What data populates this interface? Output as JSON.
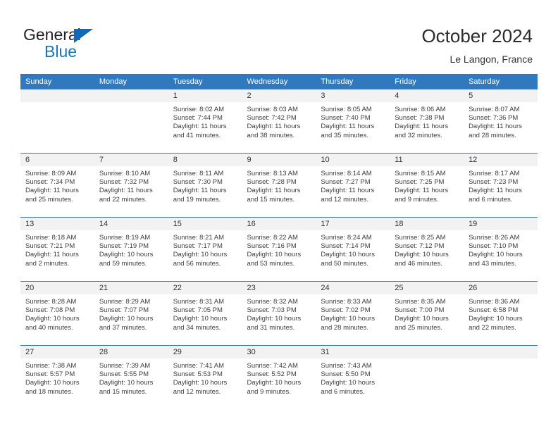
{
  "brand": {
    "name_part1": "General",
    "name_part2": "Blue",
    "logo_icon": "triangle-logo-icon",
    "accent_color": "#1b75bb"
  },
  "header": {
    "title": "October 2024",
    "subtitle": "Le Langon, France"
  },
  "colors": {
    "header_blue": "#3179be",
    "daynum_gray": "#f2f2f2",
    "text": "#3d3d3d"
  },
  "calendar": {
    "weekday_headers": [
      "Sunday",
      "Monday",
      "Tuesday",
      "Wednesday",
      "Thursday",
      "Friday",
      "Saturday"
    ],
    "labels": {
      "sunrise": "Sunrise:",
      "sunset": "Sunset:",
      "daylight": "Daylight:"
    },
    "weeks": [
      [
        {
          "day": "",
          "sunrise": "",
          "sunset": "",
          "daylight_line1": "",
          "daylight_line2": ""
        },
        {
          "day": "",
          "sunrise": "",
          "sunset": "",
          "daylight_line1": "",
          "daylight_line2": ""
        },
        {
          "day": "1",
          "sunrise": "Sunrise: 8:02 AM",
          "sunset": "Sunset: 7:44 PM",
          "daylight_line1": "Daylight: 11 hours",
          "daylight_line2": "and 41 minutes."
        },
        {
          "day": "2",
          "sunrise": "Sunrise: 8:03 AM",
          "sunset": "Sunset: 7:42 PM",
          "daylight_line1": "Daylight: 11 hours",
          "daylight_line2": "and 38 minutes."
        },
        {
          "day": "3",
          "sunrise": "Sunrise: 8:05 AM",
          "sunset": "Sunset: 7:40 PM",
          "daylight_line1": "Daylight: 11 hours",
          "daylight_line2": "and 35 minutes."
        },
        {
          "day": "4",
          "sunrise": "Sunrise: 8:06 AM",
          "sunset": "Sunset: 7:38 PM",
          "daylight_line1": "Daylight: 11 hours",
          "daylight_line2": "and 32 minutes."
        },
        {
          "day": "5",
          "sunrise": "Sunrise: 8:07 AM",
          "sunset": "Sunset: 7:36 PM",
          "daylight_line1": "Daylight: 11 hours",
          "daylight_line2": "and 28 minutes."
        }
      ],
      [
        {
          "day": "6",
          "sunrise": "Sunrise: 8:09 AM",
          "sunset": "Sunset: 7:34 PM",
          "daylight_line1": "Daylight: 11 hours",
          "daylight_line2": "and 25 minutes."
        },
        {
          "day": "7",
          "sunrise": "Sunrise: 8:10 AM",
          "sunset": "Sunset: 7:32 PM",
          "daylight_line1": "Daylight: 11 hours",
          "daylight_line2": "and 22 minutes."
        },
        {
          "day": "8",
          "sunrise": "Sunrise: 8:11 AM",
          "sunset": "Sunset: 7:30 PM",
          "daylight_line1": "Daylight: 11 hours",
          "daylight_line2": "and 19 minutes."
        },
        {
          "day": "9",
          "sunrise": "Sunrise: 8:13 AM",
          "sunset": "Sunset: 7:28 PM",
          "daylight_line1": "Daylight: 11 hours",
          "daylight_line2": "and 15 minutes."
        },
        {
          "day": "10",
          "sunrise": "Sunrise: 8:14 AM",
          "sunset": "Sunset: 7:27 PM",
          "daylight_line1": "Daylight: 11 hours",
          "daylight_line2": "and 12 minutes."
        },
        {
          "day": "11",
          "sunrise": "Sunrise: 8:15 AM",
          "sunset": "Sunset: 7:25 PM",
          "daylight_line1": "Daylight: 11 hours",
          "daylight_line2": "and 9 minutes."
        },
        {
          "day": "12",
          "sunrise": "Sunrise: 8:17 AM",
          "sunset": "Sunset: 7:23 PM",
          "daylight_line1": "Daylight: 11 hours",
          "daylight_line2": "and 6 minutes."
        }
      ],
      [
        {
          "day": "13",
          "sunrise": "Sunrise: 8:18 AM",
          "sunset": "Sunset: 7:21 PM",
          "daylight_line1": "Daylight: 11 hours",
          "daylight_line2": "and 2 minutes."
        },
        {
          "day": "14",
          "sunrise": "Sunrise: 8:19 AM",
          "sunset": "Sunset: 7:19 PM",
          "daylight_line1": "Daylight: 10 hours",
          "daylight_line2": "and 59 minutes."
        },
        {
          "day": "15",
          "sunrise": "Sunrise: 8:21 AM",
          "sunset": "Sunset: 7:17 PM",
          "daylight_line1": "Daylight: 10 hours",
          "daylight_line2": "and 56 minutes."
        },
        {
          "day": "16",
          "sunrise": "Sunrise: 8:22 AM",
          "sunset": "Sunset: 7:16 PM",
          "daylight_line1": "Daylight: 10 hours",
          "daylight_line2": "and 53 minutes."
        },
        {
          "day": "17",
          "sunrise": "Sunrise: 8:24 AM",
          "sunset": "Sunset: 7:14 PM",
          "daylight_line1": "Daylight: 10 hours",
          "daylight_line2": "and 50 minutes."
        },
        {
          "day": "18",
          "sunrise": "Sunrise: 8:25 AM",
          "sunset": "Sunset: 7:12 PM",
          "daylight_line1": "Daylight: 10 hours",
          "daylight_line2": "and 46 minutes."
        },
        {
          "day": "19",
          "sunrise": "Sunrise: 8:26 AM",
          "sunset": "Sunset: 7:10 PM",
          "daylight_line1": "Daylight: 10 hours",
          "daylight_line2": "and 43 minutes."
        }
      ],
      [
        {
          "day": "20",
          "sunrise": "Sunrise: 8:28 AM",
          "sunset": "Sunset: 7:08 PM",
          "daylight_line1": "Daylight: 10 hours",
          "daylight_line2": "and 40 minutes."
        },
        {
          "day": "21",
          "sunrise": "Sunrise: 8:29 AM",
          "sunset": "Sunset: 7:07 PM",
          "daylight_line1": "Daylight: 10 hours",
          "daylight_line2": "and 37 minutes."
        },
        {
          "day": "22",
          "sunrise": "Sunrise: 8:31 AM",
          "sunset": "Sunset: 7:05 PM",
          "daylight_line1": "Daylight: 10 hours",
          "daylight_line2": "and 34 minutes."
        },
        {
          "day": "23",
          "sunrise": "Sunrise: 8:32 AM",
          "sunset": "Sunset: 7:03 PM",
          "daylight_line1": "Daylight: 10 hours",
          "daylight_line2": "and 31 minutes."
        },
        {
          "day": "24",
          "sunrise": "Sunrise: 8:33 AM",
          "sunset": "Sunset: 7:02 PM",
          "daylight_line1": "Daylight: 10 hours",
          "daylight_line2": "and 28 minutes."
        },
        {
          "day": "25",
          "sunrise": "Sunrise: 8:35 AM",
          "sunset": "Sunset: 7:00 PM",
          "daylight_line1": "Daylight: 10 hours",
          "daylight_line2": "and 25 minutes."
        },
        {
          "day": "26",
          "sunrise": "Sunrise: 8:36 AM",
          "sunset": "Sunset: 6:58 PM",
          "daylight_line1": "Daylight: 10 hours",
          "daylight_line2": "and 22 minutes."
        }
      ],
      [
        {
          "day": "27",
          "sunrise": "Sunrise: 7:38 AM",
          "sunset": "Sunset: 5:57 PM",
          "daylight_line1": "Daylight: 10 hours",
          "daylight_line2": "and 18 minutes."
        },
        {
          "day": "28",
          "sunrise": "Sunrise: 7:39 AM",
          "sunset": "Sunset: 5:55 PM",
          "daylight_line1": "Daylight: 10 hours",
          "daylight_line2": "and 15 minutes."
        },
        {
          "day": "29",
          "sunrise": "Sunrise: 7:41 AM",
          "sunset": "Sunset: 5:53 PM",
          "daylight_line1": "Daylight: 10 hours",
          "daylight_line2": "and 12 minutes."
        },
        {
          "day": "30",
          "sunrise": "Sunrise: 7:42 AM",
          "sunset": "Sunset: 5:52 PM",
          "daylight_line1": "Daylight: 10 hours",
          "daylight_line2": "and 9 minutes."
        },
        {
          "day": "31",
          "sunrise": "Sunrise: 7:43 AM",
          "sunset": "Sunset: 5:50 PM",
          "daylight_line1": "Daylight: 10 hours",
          "daylight_line2": "and 6 minutes."
        },
        {
          "day": "",
          "sunrise": "",
          "sunset": "",
          "daylight_line1": "",
          "daylight_line2": ""
        },
        {
          "day": "",
          "sunrise": "",
          "sunset": "",
          "daylight_line1": "",
          "daylight_line2": ""
        }
      ]
    ]
  }
}
